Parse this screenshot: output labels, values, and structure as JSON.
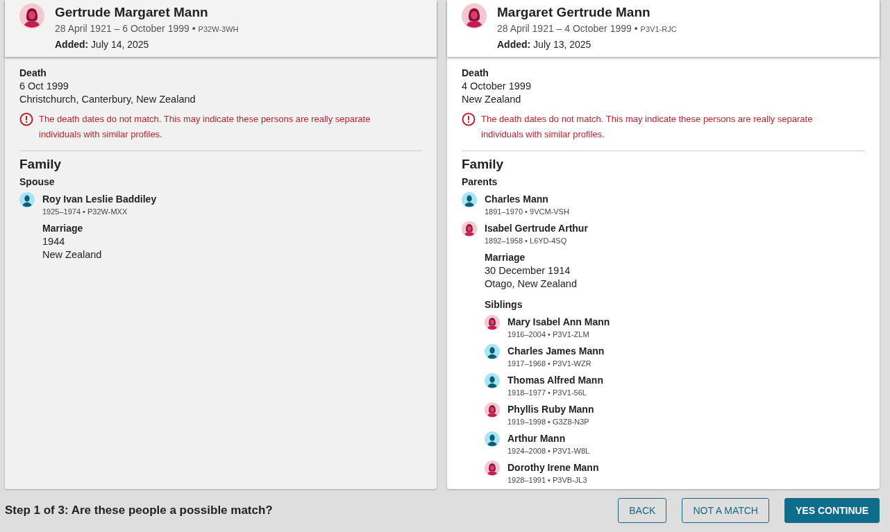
{
  "panels": [
    {
      "shaded": true,
      "person": {
        "kind": "female",
        "name": "Gertrude Margaret Mann",
        "dates": "28 April 1921 – 6 October 1999 •",
        "pid": "P32W-3WH",
        "added_label": "Added:",
        "added_value": "July 14, 2025"
      },
      "death": {
        "label": "Death",
        "date": "6 Oct 1999",
        "place": "Christchurch, Canterbury, New Zealand"
      },
      "warning": "The death dates do not match. This may indicate these persons are really separate individuals with similar profiles.",
      "family": {
        "heading": "Family",
        "relation": "Spouse",
        "members": [
          {
            "kind": "male",
            "name": "Roy Ivan Leslie Baddiley",
            "years": "1925–1974 •",
            "pid": "P32W-MXX"
          }
        ],
        "marriage": {
          "label": "Marriage",
          "date": "1944",
          "place": "New Zealand"
        }
      }
    },
    {
      "shaded": false,
      "person": {
        "kind": "female",
        "name": "Margaret Gertrude Mann",
        "dates": "28 April 1921 – 4 October 1999 •",
        "pid": "P3V1-RJC",
        "added_label": "Added:",
        "added_value": "July 13, 2025"
      },
      "death": {
        "label": "Death",
        "date": "4 October 1999",
        "place": "New Zealand"
      },
      "warning": "The death dates do not match. This may indicate these persons are really separate individuals with similar profiles.",
      "family": {
        "heading": "Family",
        "relation": "Parents",
        "members": [
          {
            "kind": "male",
            "name": "Charles Mann",
            "years": "1891–1970 •",
            "pid": "9VCM-VSH"
          },
          {
            "kind": "female",
            "name": "Isabel Gertrude Arthur",
            "years": "1892–1958 •",
            "pid": "L6YD-4SQ"
          }
        ],
        "marriage": {
          "label": "Marriage",
          "date": "30 December 1914",
          "place": "Otago, New Zealand"
        },
        "siblings": {
          "label": "Siblings",
          "members": [
            {
              "kind": "female",
              "name": "Mary Isabel Ann Mann",
              "years": "1916–2004 •",
              "pid": "P3V1-ZLM"
            },
            {
              "kind": "male",
              "name": "Charles James Mann",
              "years": "1917–1968 •",
              "pid": "P3V1-WZR"
            },
            {
              "kind": "male",
              "name": "Thomas Alfred Mann",
              "years": "1918–1977 •",
              "pid": "P3V1-56L"
            },
            {
              "kind": "female",
              "name": "Phyllis Ruby Mann",
              "years": "1919–1998 •",
              "pid": "G3Z8-N3P"
            },
            {
              "kind": "male",
              "name": "Arthur Mann",
              "years": "1924–2008 •",
              "pid": "P3V1-W8L"
            },
            {
              "kind": "female",
              "name": "Dorothy Irene Mann",
              "years": "1928–1991 •",
              "pid": "P3VB-JL3"
            }
          ]
        }
      }
    }
  ],
  "footer": {
    "step": "Step 1 of 3: Are these people a possible match?",
    "buttons": [
      {
        "kind": "outline",
        "label": "BACK"
      },
      {
        "kind": "outline",
        "label": "NOT A MATCH"
      },
      {
        "kind": "primary",
        "label": "YES CONTINUE"
      }
    ]
  }
}
